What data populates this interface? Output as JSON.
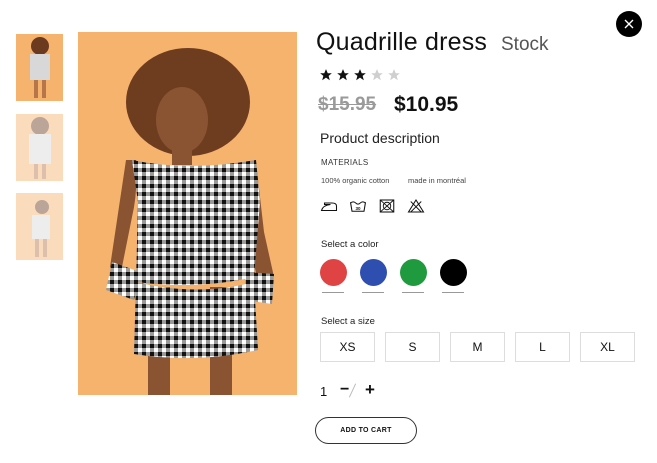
{
  "product": {
    "title": "Quadrille dress",
    "stock": "Stock",
    "rating": 3,
    "rating_max": 5,
    "old_price": "$15.95",
    "new_price": "$10.95"
  },
  "description": {
    "heading": "Product description",
    "materials_label": "MATERIALS",
    "material_1": "100% organic cotton",
    "material_2": "made in montréal",
    "care_icons": [
      "iron-icon",
      "wash-30-icon",
      "no-dry-clean-icon",
      "no-bleach-icon"
    ]
  },
  "colors": {
    "label": "Select a color",
    "options": [
      "#e04343",
      "#2f4fb0",
      "#1f9a3e",
      "#000000"
    ]
  },
  "sizes": {
    "label": "Select a size",
    "options": [
      "XS",
      "S",
      "M",
      "L",
      "XL"
    ]
  },
  "quantity": {
    "value": "1",
    "minus": "−",
    "plus": "+"
  },
  "cart": {
    "label": "ADD TO CART"
  },
  "accent": {
    "photo_bg": "#f6b36d",
    "close_bg": "#000000"
  }
}
